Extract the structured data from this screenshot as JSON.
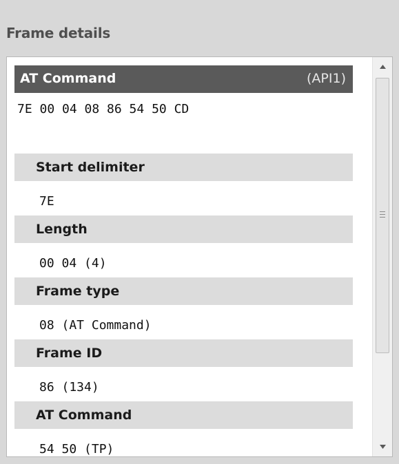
{
  "panel": {
    "title": "Frame details"
  },
  "frame": {
    "title": "AT Command",
    "api_label": "(API1)",
    "raw_bytes": "7E 00 04 08 86 54 50 CD"
  },
  "fields": [
    {
      "label": "Start delimiter",
      "value": "7E"
    },
    {
      "label": "Length",
      "value": "00 04 (4)"
    },
    {
      "label": "Frame type",
      "value": "08 (AT Command)"
    },
    {
      "label": "Frame ID",
      "value": "86 (134)"
    },
    {
      "label": "AT Command",
      "value": "54 50 (TP)"
    }
  ],
  "scrollbar": {
    "up_icon": "triangle-up",
    "down_icon": "triangle-down",
    "grip_icon": "grip-lines"
  }
}
